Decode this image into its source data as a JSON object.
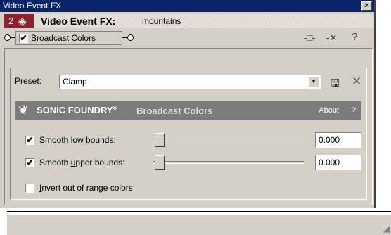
{
  "window": {
    "title": "Video Event FX",
    "close_glyph": "✕"
  },
  "fx_header": {
    "chain_count": "2",
    "icon": "fx-plugin-icon",
    "label": "Video Event FX:",
    "event_name": "mountains"
  },
  "chain": {
    "plugin_name": "Broadcast Colors",
    "plugin_enabled": true
  },
  "preset": {
    "label": "Preset:",
    "value": "Clamp"
  },
  "banner": {
    "brand": "SONIC FOUNDRY",
    "trademark": "®",
    "plugin_title": "Broadcast Colors",
    "about": "About",
    "help": "?"
  },
  "controls": {
    "smooth_low": {
      "label_pre": "Smooth ",
      "label_ul": "l",
      "label_post": "ow bounds:",
      "checked": true,
      "value": "0.000",
      "slider_level": 0
    },
    "smooth_upper": {
      "label_pre": "Smooth ",
      "label_ul": "u",
      "label_post": "pper bounds:",
      "checked": true,
      "value": "0.000",
      "slider_level": 0
    },
    "invert": {
      "label_ul": "I",
      "label_post": "nvert out of range colors",
      "checked": false
    }
  },
  "check_glyph": "✔",
  "colors": {
    "titlebar": "#0a246a",
    "fx_badge": "#8a2230",
    "banner": "#7b7b7b",
    "face": "#d4d0c8"
  }
}
